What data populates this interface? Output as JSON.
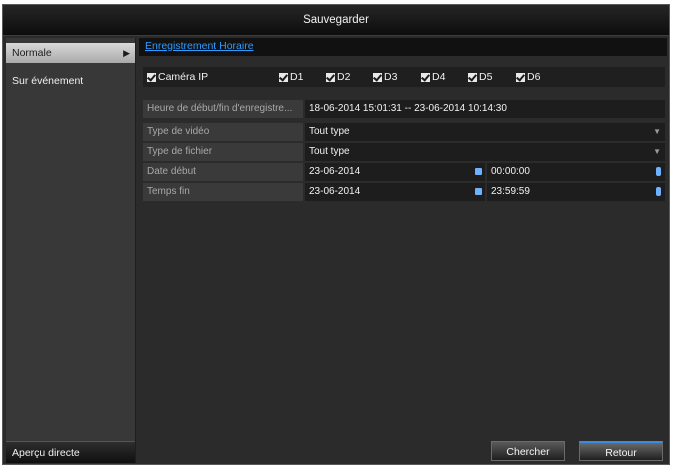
{
  "window": {
    "title": "Sauvegarder"
  },
  "sidebar": {
    "items": [
      {
        "label": "Normale",
        "active": true
      },
      {
        "label": "Sur événement",
        "active": false
      }
    ],
    "bottom_label": "Aperçu directe"
  },
  "tabs": [
    {
      "label": "Enregistrement Horaire"
    }
  ],
  "camera": {
    "ip_label": "Caméra IP",
    "channels": [
      "D1",
      "D2",
      "D3",
      "D4",
      "D5",
      "D6"
    ]
  },
  "fields": {
    "range": {
      "label": "Heure de début/fin d'enregistre...",
      "value": "18-06-2014 15:01:31 -- 23-06-2014 10:14:30"
    },
    "video_type": {
      "label": "Type de vidéo",
      "value": "Tout type"
    },
    "file_type": {
      "label": "Type de fichier",
      "value": "Tout type"
    },
    "start": {
      "label": "Date début",
      "date": "23-06-2014",
      "time": "00:00:00"
    },
    "end": {
      "label": "Temps fin",
      "date": "23-06-2014",
      "time": "23:59:59"
    }
  },
  "buttons": {
    "search": "Chercher",
    "back": "Retour"
  },
  "colors": {
    "link": "#2e9bff",
    "accent": "#3a8dde",
    "icon": "#6fb0ff"
  }
}
